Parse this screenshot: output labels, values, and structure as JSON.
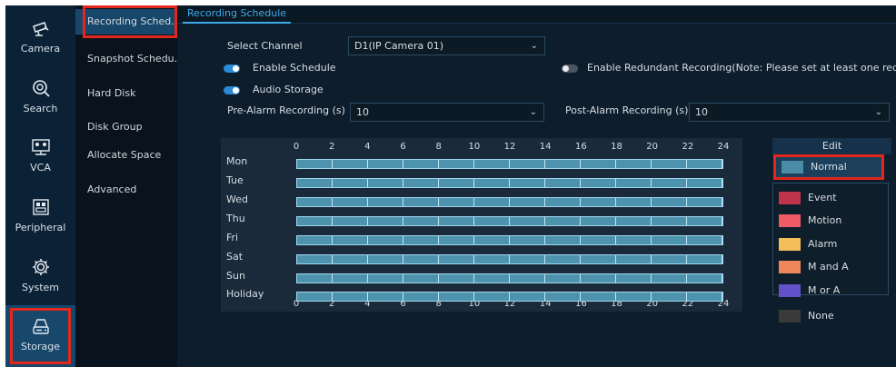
{
  "nav": {
    "items": [
      {
        "label": "Camera",
        "icon": "camera-icon"
      },
      {
        "label": "Search",
        "icon": "search-icon"
      },
      {
        "label": "VCA",
        "icon": "vca-icon"
      },
      {
        "label": "Peripheral",
        "icon": "peripheral-icon"
      },
      {
        "label": "System",
        "icon": "system-gear-icon"
      },
      {
        "label": "Storage",
        "icon": "storage-icon",
        "active": true
      }
    ]
  },
  "submenu": {
    "items": [
      {
        "label": "Recording Sched...",
        "active": true
      },
      {
        "label": "Snapshot Schedu.."
      },
      {
        "label": "Hard Disk"
      },
      {
        "label": "Disk Group"
      },
      {
        "label": "Allocate Space"
      },
      {
        "label": "Advanced"
      }
    ]
  },
  "tab": {
    "label": "Recording Schedule"
  },
  "form": {
    "channel_label": "Select Channel",
    "channel_value": "D1(IP Camera 01)",
    "enable_schedule_label": "Enable Schedule",
    "enable_schedule_on": true,
    "redundant_label": "Enable Redundant Recording(Note: Please set at least one red...",
    "redundant_on": false,
    "audio_label": "Audio Storage",
    "audio_on": true,
    "pre_alarm_label": "Pre-Alarm Recording (s)",
    "pre_alarm_value": "10",
    "post_alarm_label": "Post-Alarm Recording (s)",
    "post_alarm_value": "10"
  },
  "schedule": {
    "hours": [
      "0",
      "2",
      "4",
      "6",
      "8",
      "10",
      "12",
      "14",
      "16",
      "18",
      "20",
      "22",
      "24"
    ],
    "days": [
      "Mon",
      "Tue",
      "Wed",
      "Thu",
      "Fri",
      "Sat",
      "Sun",
      "Holiday"
    ],
    "all_days_type": "Normal",
    "all_days_coverage": "0-24"
  },
  "edit": {
    "title": "Edit",
    "types": [
      {
        "label": "Normal",
        "color": "#4a8ba6",
        "selected": true
      },
      {
        "label": "Event",
        "color": "#c1334a"
      },
      {
        "label": "Motion",
        "color": "#ee5a66"
      },
      {
        "label": "Alarm",
        "color": "#f3bd58"
      },
      {
        "label": "M and A",
        "color": "#f0875a"
      },
      {
        "label": "M or A",
        "color": "#6152c9"
      },
      {
        "label": "None",
        "color": "#3a3a3a"
      }
    ]
  },
  "colors": {
    "accent": "#3fa8e8",
    "highlight": "#e3271d",
    "active_bg": "#17476a"
  }
}
